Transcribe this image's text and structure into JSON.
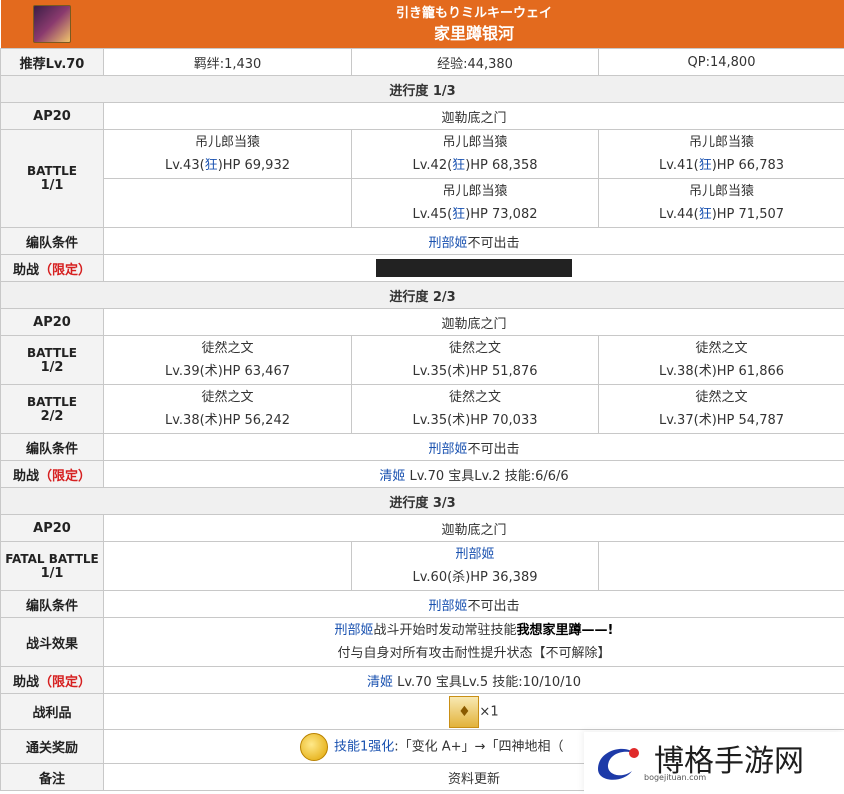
{
  "header": {
    "subtitle": "引き籠もりミルキーウェイ",
    "title": "家里蹲银河"
  },
  "summary": {
    "label": "推荐Lv.70",
    "bond": "羁绊:1,430",
    "exp": "经验:44,380",
    "qp": "QP:14,800"
  },
  "p1": {
    "heading": "进行度 1/3",
    "ap": "AP20",
    "place": "迦勒底之门",
    "battle_label": "BATTLE",
    "battle_num": "1/1",
    "enemies": [
      {
        "name": "吊儿郎当猿",
        "pre": "Lv.43(",
        "cls": "狂",
        "post": ")HP 69,932"
      },
      {
        "name": "吊儿郎当猿",
        "pre": "Lv.42(",
        "cls": "狂",
        "post": ")HP 68,358"
      },
      {
        "name": "吊儿郎当猿",
        "pre": "Lv.41(",
        "cls": "狂",
        "post": ")HP 66,783"
      },
      {
        "name": "吊儿郎当猿",
        "pre": "Lv.45(",
        "cls": "狂",
        "post": ")HP 73,082"
      },
      {
        "name": "吊儿郎当猿",
        "pre": "Lv.44(",
        "cls": "狂",
        "post": ")HP 71,507"
      }
    ],
    "cond_label": "编队条件",
    "cond_name": "刑部姬",
    "cond_text": "不可出击",
    "support_label": "助战",
    "support_limited": "（限定）"
  },
  "p2": {
    "heading": "进行度 2/3",
    "ap": "AP20",
    "place": "迦勒底之门",
    "battle1_label": "BATTLE",
    "battle1_num": "1/2",
    "battle2_label": "BATTLE",
    "battle2_num": "2/2",
    "enemies": [
      {
        "name": "徒然之文",
        "pre": "Lv.39(",
        "cls": "术",
        "post": ")HP 63,467"
      },
      {
        "name": "徒然之文",
        "pre": "Lv.35(",
        "cls": "术",
        "post": ")HP 51,876"
      },
      {
        "name": "徒然之文",
        "pre": "Lv.38(",
        "cls": "术",
        "post": ")HP 61,866"
      },
      {
        "name": "徒然之文",
        "pre": "Lv.38(",
        "cls": "术",
        "post": ")HP 56,242"
      },
      {
        "name": "徒然之文",
        "pre": "Lv.35(",
        "cls": "术",
        "post": ")HP 70,033"
      },
      {
        "name": "徒然之文",
        "pre": "Lv.37(",
        "cls": "术",
        "post": ")HP 54,787"
      }
    ],
    "cond_label": "编队条件",
    "cond_name": "刑部姬",
    "cond_text": "不可出击",
    "support_label": "助战",
    "support_limited": "（限定）",
    "support_name": "清姬",
    "support_text": " Lv.70 宝具Lv.2 技能:6/6/6"
  },
  "p3": {
    "heading": "进行度 3/3",
    "ap": "AP20",
    "place": "迦勒底之门",
    "battle_label": "FATAL BATTLE",
    "battle_num": "1/1",
    "boss_name": "刑部姬",
    "boss_pre": "Lv.60(",
    "boss_cls": "杀",
    "boss_post": ")HP 36,389",
    "cond_label": "编队条件",
    "cond_name": "刑部姬",
    "cond_text": "不可出击",
    "effect_label": "战斗效果",
    "effect_name": "刑部姬",
    "effect_text1": "战斗开始时发动常驻技能",
    "effect_bold": "我想家里蹲——!",
    "effect_line2": "付与自身对所有攻击耐性提升状态【不可解除】",
    "support_label": "助战",
    "support_limited": "（限定）",
    "support_name": "清姬",
    "support_text": " Lv.70 宝具Lv.5 技能:10/10/10",
    "loot_label": "战利品",
    "loot_count": "×1",
    "reward_label": "通关奖励",
    "reward_link": "技能1强化",
    "reward_text": ":「变化 A+」→「四神地相（",
    "notes_label": "备注",
    "notes_text": "资料更新"
  },
  "watermark": {
    "text": "博格手游网",
    "sub": "bogejituan.com"
  }
}
